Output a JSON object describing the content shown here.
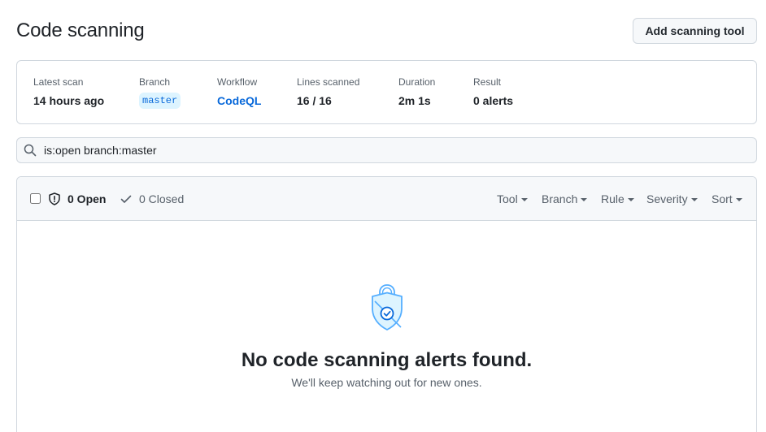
{
  "header": {
    "title": "Code scanning",
    "add_tool_label": "Add scanning tool"
  },
  "summary": {
    "latest_scan_label": "Latest scan",
    "latest_scan_value": "14 hours ago",
    "branch_label": "Branch",
    "branch_value": "master",
    "workflow_label": "Workflow",
    "workflow_value": "CodeQL",
    "lines_label": "Lines scanned",
    "lines_value": "16 / 16",
    "duration_label": "Duration",
    "duration_value": "2m 1s",
    "result_label": "Result",
    "result_value": "0 alerts"
  },
  "search": {
    "value": "is:open branch:master"
  },
  "alerts": {
    "open_label": "0 Open",
    "closed_label": "0 Closed",
    "filters": {
      "tool": "Tool",
      "branch": "Branch",
      "rule": "Rule",
      "severity": "Severity",
      "sort": "Sort"
    }
  },
  "empty_state": {
    "title": "No code scanning alerts found.",
    "subtitle": "We'll keep watching out for new ones."
  },
  "colors": {
    "accent": "#0969da",
    "border": "#d0d7de",
    "muted": "#57606a",
    "shield_blue": "#54aeff"
  }
}
